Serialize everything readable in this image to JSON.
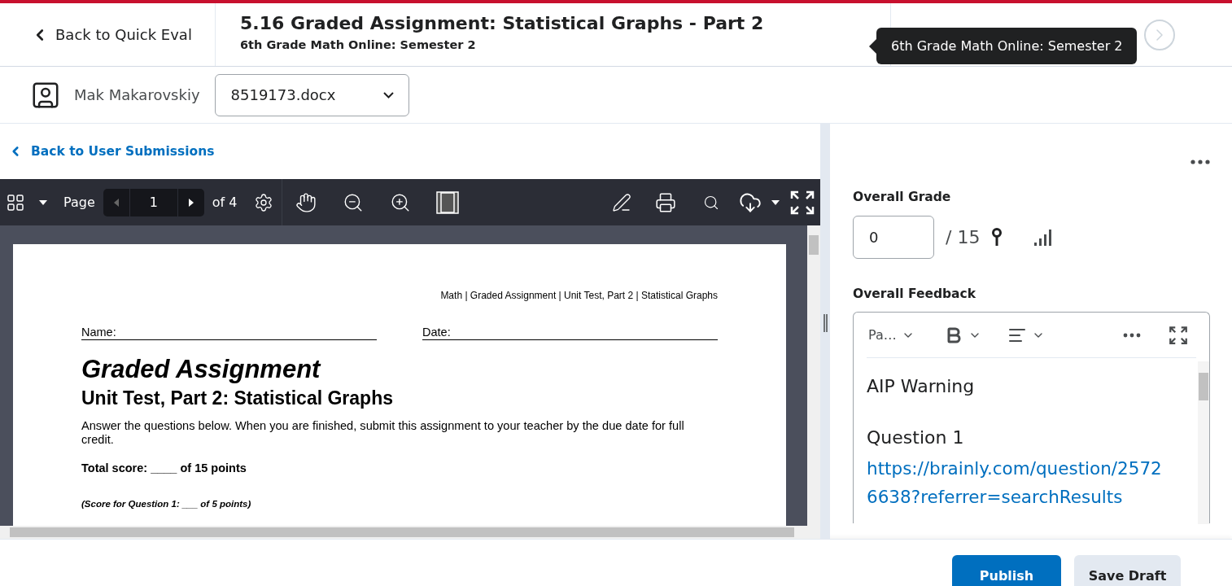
{
  "header": {
    "back_link": "Back to Quick Eval",
    "title": "5.16 Graded Assignment: Statistical Graphs - Part 2",
    "subtitle": "6th Grade Math Online: Semester 2",
    "tooltip": "6th Grade Math Online: Semester 2"
  },
  "user": {
    "name": "Mak Makarovskiy",
    "file_select": {
      "value": "8519173.docx"
    }
  },
  "viewer": {
    "back_link": "Back to User Submissions",
    "toolbar": {
      "page_label": "Page",
      "page_value": "1",
      "page_total": "of 4"
    },
    "document": {
      "header_line": "Math | Graded Assignment | Unit Test, Part 2 | Statistical Graphs",
      "name_label": "Name:",
      "date_label": "Date:",
      "title": "Graded Assignment",
      "subtitle": "Unit Test, Part 2: Statistical Graphs",
      "instructions": "Answer the questions below. When you are finished, submit this assignment to your teacher by the due date for full credit.",
      "total_score": "Total score: ____ of 15 points",
      "score_line": "(Score for Question 1: ___ of 5 points)"
    }
  },
  "grading": {
    "grade_label": "Overall Grade",
    "grade_value": "0",
    "grade_max": "/ 15",
    "feedback_label": "Overall Feedback",
    "editor": {
      "format_value": "Pa…",
      "content": [
        {
          "kind": "text",
          "text": "AIP Warning"
        },
        {
          "kind": "text",
          "text": "Question 1"
        },
        {
          "kind": "link",
          "text": "https://brainly.com/question/25726638?referrer=searchResults"
        }
      ]
    }
  },
  "buttons": [
    {
      "label": "Publish",
      "kind": "primary"
    },
    {
      "label": "Save Draft",
      "kind": "secondary"
    }
  ]
}
